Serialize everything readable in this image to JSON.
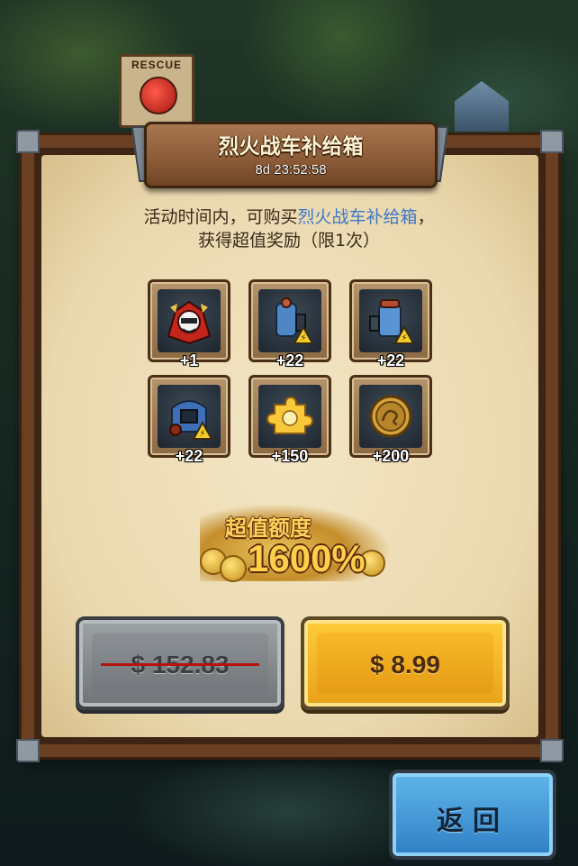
{
  "background": {
    "rescue_sign": "RESCUE"
  },
  "dialog": {
    "title": "烈火战车补给箱",
    "timer": "8d 23:52:58",
    "description_prefix": "活动时间内，可购买",
    "description_highlight": "烈火战车补给箱",
    "description_suffix": "，",
    "description_line2": "获得超值奖励（限1次）",
    "highlight_color": "#3f78c8"
  },
  "items": [
    {
      "icon": "war-chariot-icon",
      "qty": "+1"
    },
    {
      "icon": "blue-engine-part-icon",
      "qty": "+22"
    },
    {
      "icon": "blue-tank-part-icon",
      "qty": "+22"
    },
    {
      "icon": "blue-armor-part-icon",
      "qty": "+22"
    },
    {
      "icon": "gold-puzzle-piece-icon",
      "qty": "+150"
    },
    {
      "icon": "dragon-gold-coin-icon",
      "qty": "+200"
    }
  ],
  "value_banner": {
    "label": "超值额度",
    "percent": "1600%"
  },
  "buttons": {
    "original_price": "$ 152.83",
    "sale_price": "$ 8.99",
    "back": "返回"
  },
  "colors": {
    "sale_button": "#f7b828",
    "back_button": "#3f96d6",
    "strike": "#b4140e"
  }
}
